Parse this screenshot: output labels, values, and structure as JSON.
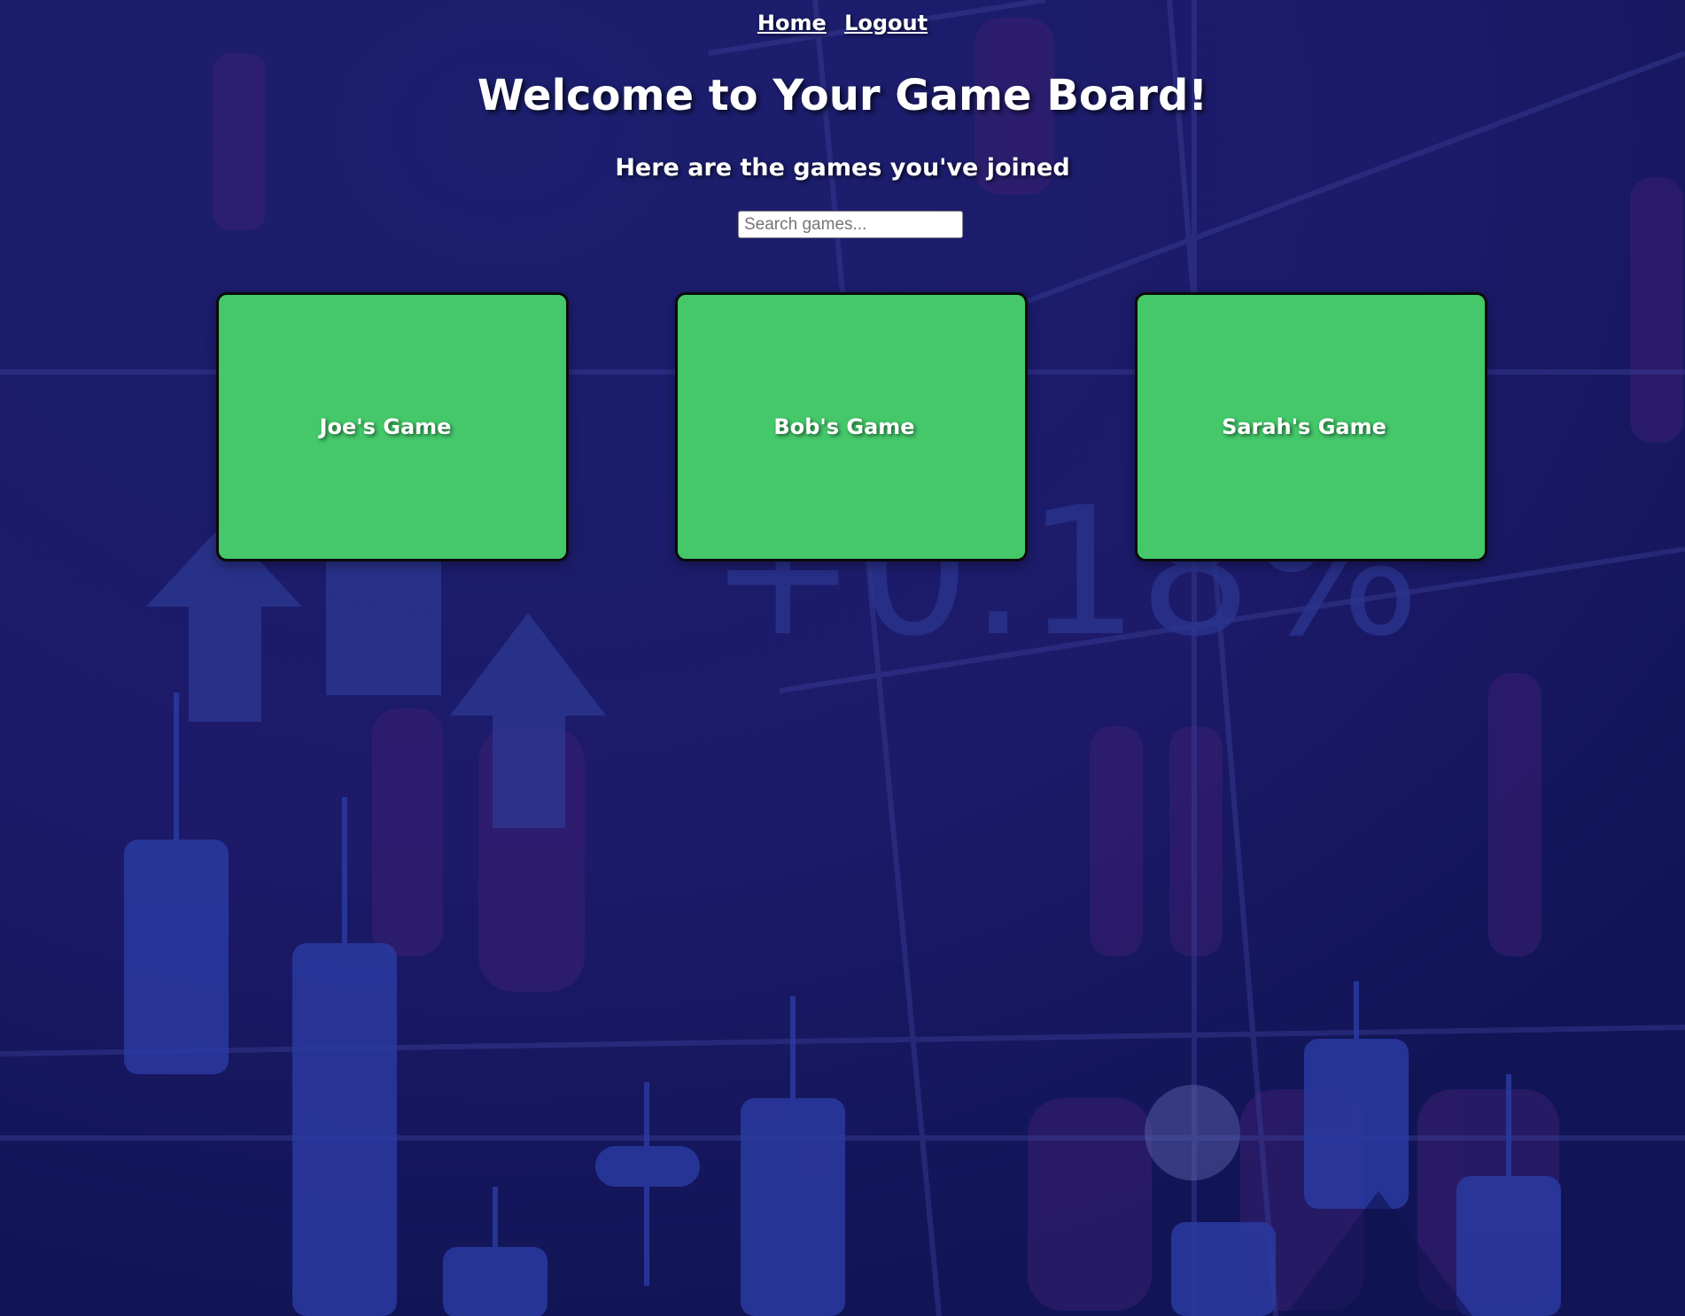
{
  "nav": {
    "links": [
      {
        "label": "Home"
      },
      {
        "label": "Logout"
      }
    ]
  },
  "header": {
    "title": "Welcome to Your Game Board!",
    "subtitle": "Here are the games you've joined"
  },
  "search": {
    "placeholder": "Search games...",
    "value": ""
  },
  "games": [
    {
      "name": "Joe's Game"
    },
    {
      "name": "Bob's Game"
    },
    {
      "name": "Sarah's Game"
    }
  ],
  "background": {
    "ticker_text": "+0.18%"
  },
  "colors": {
    "background": "#161a63",
    "card": "#44c86a",
    "card_border": "#0a0a0a",
    "text": "#ffffff"
  }
}
